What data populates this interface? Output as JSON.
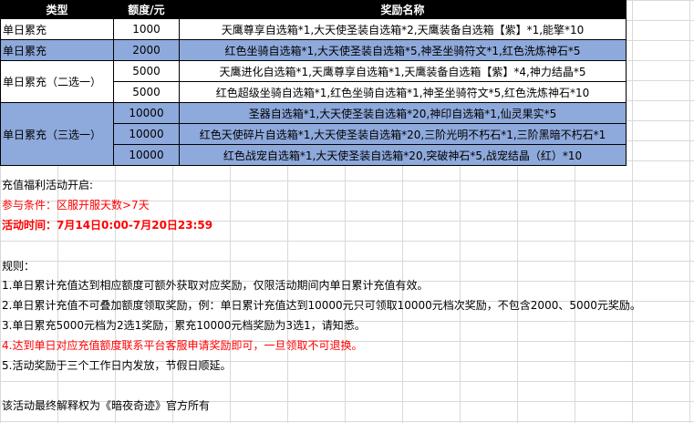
{
  "table": {
    "headers": [
      "类型",
      "额度/元",
      "奖励名称"
    ],
    "rows": [
      {
        "type": "单日累充",
        "amount": "1000",
        "reward": "天鹰尊享自选箱*1,大天使圣装自选箱*2,天鹰装备自选箱【紫】*1,能擎*10"
      },
      {
        "type": "单日累充",
        "amount": "2000",
        "reward": "红色坐骑自选箱*1,大天使圣装自选箱*5,神圣坐骑符文*1,红色洗炼神石*5"
      },
      {
        "type": "单日累充（二选一）",
        "amount": "5000",
        "reward": "天鹰进化自选箱*1,天鹰尊享自选箱*1,天鹰装备自选箱【紫】*4,神力结晶*5"
      },
      {
        "type": "",
        "amount": "5000",
        "reward": "红色超级坐骑自选箱*1,红色坐骑自选箱*1,神圣坐骑符文*5,红色洗炼神石*10"
      },
      {
        "type": "单日累充（三选一）",
        "amount": "10000",
        "reward": "圣器自选箱*1,大天使圣装自选箱*20,神印自选箱*1,仙灵果实*5"
      },
      {
        "type": "",
        "amount": "10000",
        "reward": "红色天使碎片自选箱*1,大天使圣装自选箱*20,三阶光明不朽石*1,三阶黑暗不朽石*1"
      },
      {
        "type": "",
        "amount": "10000",
        "reward": "红色战宠自选箱*1,大天使圣装自选箱*20,突破神石*5,战宠结晶（红）*10"
      }
    ]
  },
  "notice": {
    "open": "充值福利活动开启:",
    "condition": "参与条件：区服开服天数>7天",
    "time": "活动时间：7月14日0:00-7月20日23:59"
  },
  "rules": {
    "title": "规则：",
    "items": [
      "1.单日累计充值达到相应额度可额外获取对应奖励，仅限活动期间内单日累计充值有效。",
      "2.单日累计充值不可叠加额度领取奖励，例：单日累计充值达到10000元只可领取10000元档次奖励，不包含2000、5000元奖励。",
      "3.单日累充5000元档为2选1奖励，累充10000元档奖励为3选1，请知悉。",
      "4.达到单日对应充值额度联系平台客服申请奖励即可，一旦领取不可退换。",
      "5.活动奖励于三个工作日内发放，节假日顺延。"
    ]
  },
  "footer": "该活动最终解释权为《暗夜奇迹》官方所有",
  "colors": {
    "header_bg": "#000000",
    "blue_row": "#8ea9db",
    "red_text": "#ff0000"
  }
}
